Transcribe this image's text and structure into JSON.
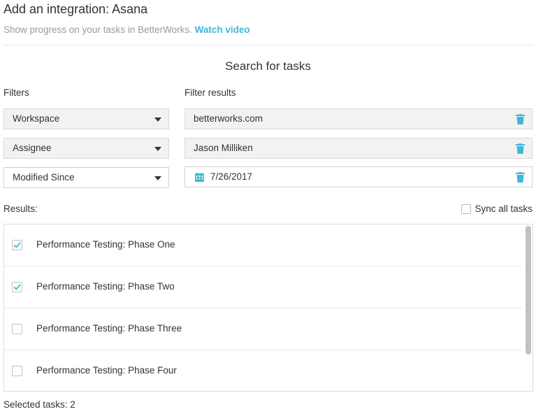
{
  "header": {
    "title": "Add an integration: Asana",
    "subtitle": "Show progress on your tasks in BetterWorks.",
    "watch_video": "Watch video"
  },
  "search": {
    "title": "Search for tasks",
    "filters_label": "Filters",
    "results_label": "Filter results"
  },
  "filters": [
    {
      "select": "Workspace",
      "value": "betterworks.com"
    },
    {
      "select": "Assignee",
      "value": "Jason Milliken"
    },
    {
      "select": "Modified Since",
      "value": "7/26/2017"
    }
  ],
  "results": {
    "label": "Results:",
    "sync_all": "Sync all tasks",
    "sync_all_checked": false,
    "items": [
      {
        "label": "Performance Testing: Phase One",
        "checked": true
      },
      {
        "label": "Performance Testing: Phase Two",
        "checked": true
      },
      {
        "label": "Performance Testing: Phase Three",
        "checked": false
      },
      {
        "label": "Performance Testing: Phase Four",
        "checked": false
      }
    ]
  },
  "footer": {
    "selected_label": "Selected tasks: 2"
  },
  "colors": {
    "accent": "#3fb7d6",
    "muted_text": "#999999",
    "field_bg": "#f2f2f2"
  },
  "icons": {
    "trash": "trash-icon",
    "calendar": "calendar-icon",
    "caret": "chevron-down-icon",
    "check": "checkmark-icon"
  }
}
